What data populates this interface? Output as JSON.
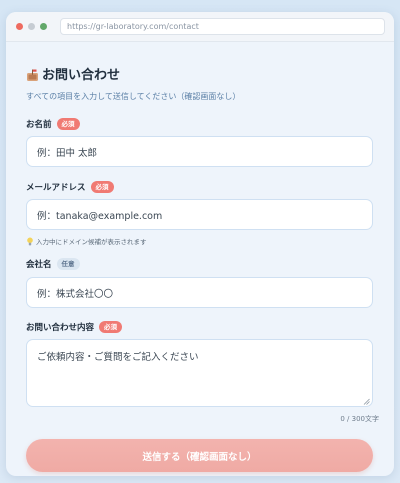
{
  "browser": {
    "url": "https://gr-laboratory.com/contact",
    "traffic_lights": [
      "#ee6b60",
      "#c6ccd3",
      "#62a86a"
    ]
  },
  "form": {
    "title": "お問い合わせ",
    "title_icon": "mailbox-icon",
    "subtitle": "すべての項目を入力して送信してください（確認画面なし）",
    "name": {
      "label": "お名前",
      "badge": "必須",
      "placeholder": "例：田中 太郎"
    },
    "email": {
      "label": "メールアドレス",
      "badge": "必須",
      "placeholder": "例：tanaka@example.com",
      "hint": "入力中にドメイン候補が表示されます",
      "hint_icon": "lightbulb-icon"
    },
    "company": {
      "label": "会社名",
      "badge": "任意",
      "placeholder": "例：株式会社〇〇"
    },
    "message": {
      "label": "お問い合わせ内容",
      "badge": "必須",
      "placeholder": "ご依頼内容・ご質問をご記入ください",
      "counter": "0 / 300文字"
    },
    "submit_label": "送信する（確認画面なし）"
  },
  "colors": {
    "required_badge": "#f07a73",
    "optional_badge": "#dbe6f1",
    "submit_button": "#f3b3ae",
    "subtitle_text": "#5a7fa6"
  }
}
